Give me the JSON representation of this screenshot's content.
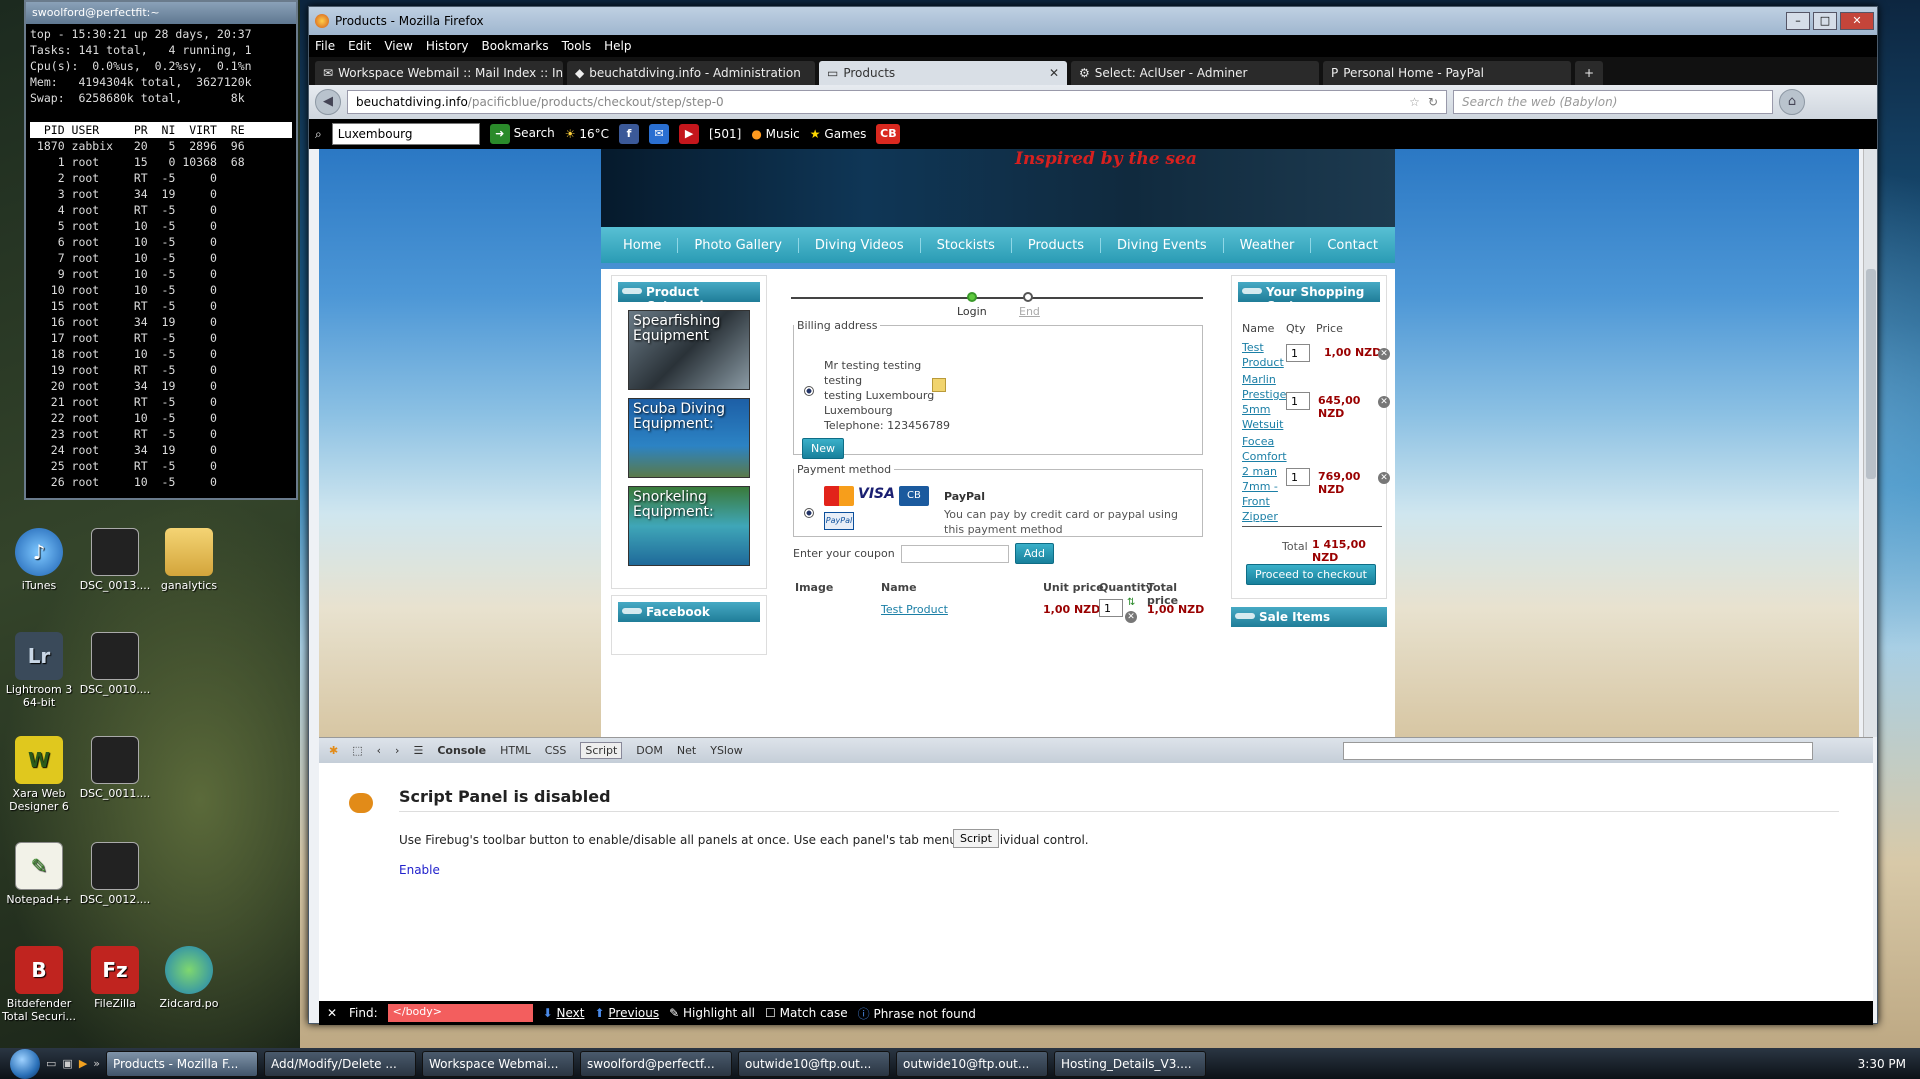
{
  "terminal": {
    "title": "swoolford@perfectfit:~",
    "lines": [
      "top - 15:30:21 up 28 days, 20:37",
      "Tasks: 141 total,   4 running, 1",
      "Cpu(s):  0.0%us,  0.2%sy,  0.1%n",
      "Mem:   4194304k total,  3627120k",
      "Swap:  6258680k total,       8k",
      "",
      "  PID USER     PR  NI  VIRT  RE",
      " 1870 zabbix   20   5  2896  96",
      "    1 root     15   0 10368  68",
      "    2 root     RT  -5     0",
      "    3 root     34  19     0",
      "    4 root     RT  -5     0",
      "    5 root     10  -5     0",
      "    6 root     10  -5     0",
      "    7 root     10  -5     0",
      "    9 root     10  -5     0",
      "   10 root     10  -5     0",
      "   15 root     RT  -5     0",
      "   16 root     34  19     0",
      "   17 root     RT  -5     0",
      "   18 root     10  -5     0",
      "   19 root     RT  -5     0",
      "   20 root     34  19     0",
      "   21 root     RT  -5     0",
      "   22 root     10  -5     0",
      "   23 root     RT  -5     0",
      "   24 root     34  19     0",
      "   25 root     RT  -5     0",
      "   26 root     10  -5     0"
    ]
  },
  "desktop_icons": {
    "itunes": "iTunes",
    "dsc1": "DSC_0013....",
    "ganalytics": "ganalytics",
    "lightroom": "Lightroom 3 64-bit",
    "dsc2": "DSC_0010....",
    "xara": "Xara Web Designer 6",
    "dsc3": "DSC_0011....",
    "notepad": "Notepad++",
    "dsc4": "DSC_0012....",
    "bitdefender": "Bitdefender Total Securi...",
    "filezilla": "FileZilla",
    "zidcard": "Zidcard.po"
  },
  "firefox": {
    "title": "Products - Mozilla Firefox",
    "menu": [
      "File",
      "Edit",
      "View",
      "History",
      "Bookmarks",
      "Tools",
      "Help"
    ],
    "tabs": [
      "Workspace Webmail :: Mail Index :: In...",
      "beuchatdiving.info - Administration",
      "Products",
      "Select: AclUser - Adminer",
      "Personal Home - PayPal"
    ],
    "url_host": "beuchatdiving.info",
    "url_path": "/pacificblue/products/checkout/step/step-0",
    "search_placeholder": "Search the web (Babylon)",
    "toolbar": {
      "location": "Luxembourg",
      "search": "Search",
      "temp": "16°C",
      "count": "[501]",
      "music": "Music",
      "games": "Games",
      "cb": "CB"
    }
  },
  "site": {
    "tagline": "Inspired by the sea",
    "nav": [
      "Home",
      "Photo Gallery",
      "Diving Videos",
      "Stockists",
      "Products",
      "Diving Events",
      "Weather",
      "Contact"
    ],
    "categories_title": "Product Categories",
    "categories": [
      "Spearfishing Equipment",
      "Scuba Diving Equipment:",
      "Snorkeling Equipment:"
    ],
    "facebook_title": "Facebook",
    "steps": {
      "login": "Login",
      "end": "End"
    },
    "billing": {
      "legend": "Billing address",
      "name": "Mr testing testing",
      "line2": "testing",
      "line3": "testing Luxembourg",
      "line4": "Luxembourg",
      "phone": "Telephone: 123456789",
      "new_btn": "New"
    },
    "payment": {
      "legend": "Payment method",
      "name": "PayPal",
      "desc": "You can pay by credit card or paypal using this payment method",
      "visa": "VISA",
      "cb": "CB",
      "paypal": "PayPal"
    },
    "coupon": {
      "label": "Enter your coupon",
      "btn": "Add"
    },
    "table": {
      "headers": [
        "Image",
        "Name",
        "Unit price",
        "Quantity",
        "Total price"
      ],
      "row": {
        "name": "Test Product",
        "unit": "1,00 NZD",
        "qty": "1",
        "total": "1,00 NZD"
      }
    },
    "cart": {
      "title": "Your Shopping Cart",
      "headers": [
        "Name",
        "Qty",
        "Price"
      ],
      "items": [
        {
          "name": "Test Product",
          "qty": "1",
          "price": "1,00 NZD"
        },
        {
          "name": "Marlin Prestige 5mm Wetsuit",
          "qty": "1",
          "price": "645,00 NZD"
        },
        {
          "name": "Focea Comfort 2 man 7mm - Front Zipper",
          "qty": "1",
          "price": "769,00 NZD"
        }
      ],
      "total_label": "Total",
      "total": "1 415,00 NZD",
      "checkout": "Proceed to checkout"
    },
    "sale_title": "Sale Items"
  },
  "firebug": {
    "tabs": [
      "Console",
      "HTML",
      "CSS",
      "Script",
      "DOM",
      "Net",
      "YSlow"
    ],
    "heading": "Script Panel is disabled",
    "message": "Use Firebug's toolbar button to enable/disable all panels at once. Use each panel's tab menu for individual control.",
    "script_btn": "Script",
    "enable": "Enable"
  },
  "findbar": {
    "label": "Find:",
    "value": "</body>",
    "next": "Next",
    "previous": "Previous",
    "highlight": "Highlight all",
    "match": "Match case",
    "status": "Phrase not found"
  },
  "taskbar": {
    "items": [
      "Products - Mozilla F...",
      "Add/Modify/Delete ...",
      "Workspace Webmai...",
      "swoolford@perfectf...",
      "outwide10@ftp.out...",
      "outwide10@ftp.out...",
      "Hosting_Details_V3...."
    ],
    "clock": "3:30 PM"
  }
}
